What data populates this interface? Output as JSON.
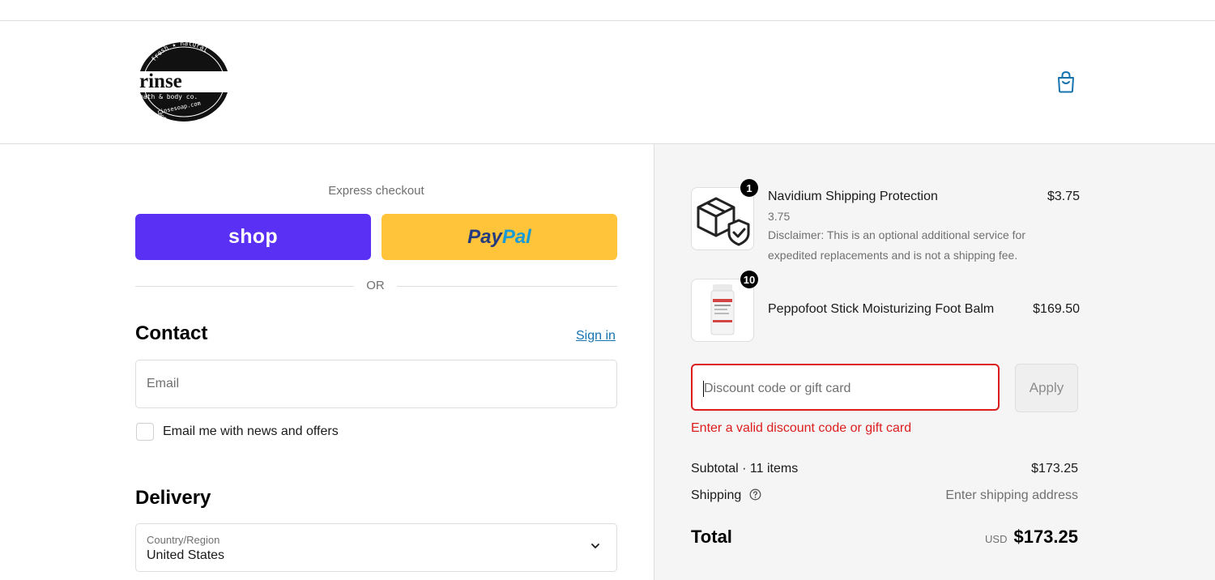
{
  "brand": {
    "logo_texts": [
      "fresh",
      "natural",
      "rinse",
      "bath & body co.",
      "www.rinsesoap.com",
      "monroe, georgia"
    ]
  },
  "express": {
    "label": "Express checkout",
    "shop_label": "shop",
    "paypal_part1": "Pay",
    "paypal_part2": "Pal",
    "or": "OR"
  },
  "contact": {
    "heading": "Contact",
    "signin": "Sign in",
    "email_placeholder": "Email",
    "newsletter_label": "Email me with news and offers",
    "newsletter_checked": false
  },
  "delivery": {
    "heading": "Delivery",
    "country_label": "Country/Region",
    "country_value": "United States"
  },
  "order": {
    "items": [
      {
        "title": "Navidium Shipping Protection",
        "variant": "3.75",
        "description": "Disclaimer: This is an optional additional service for expedited replacements and is not a shipping fee.",
        "price": "$3.75",
        "quantity": "1",
        "icon": "shipping-protection-icon"
      },
      {
        "title": "Peppofoot Stick Moisturizing Foot Balm",
        "price": "$169.50",
        "quantity": "10",
        "icon": "foot-balm-product-image"
      }
    ],
    "discount": {
      "placeholder": "Discount code or gift card",
      "apply": "Apply",
      "error": "Enter a valid discount code or gift card"
    },
    "subtotal_label": "Subtotal · 11 items",
    "subtotal_value": "$173.25",
    "shipping_label": "Shipping",
    "shipping_value": "Enter shipping address",
    "total_label": "Total",
    "currency": "USD",
    "total_value": "$173.25"
  },
  "colors": {
    "shop": "#5a31f4",
    "paypal": "#ffc439",
    "link": "#1773b0",
    "error": "#dd1d1d",
    "summary_bg": "#f5f5f5"
  }
}
